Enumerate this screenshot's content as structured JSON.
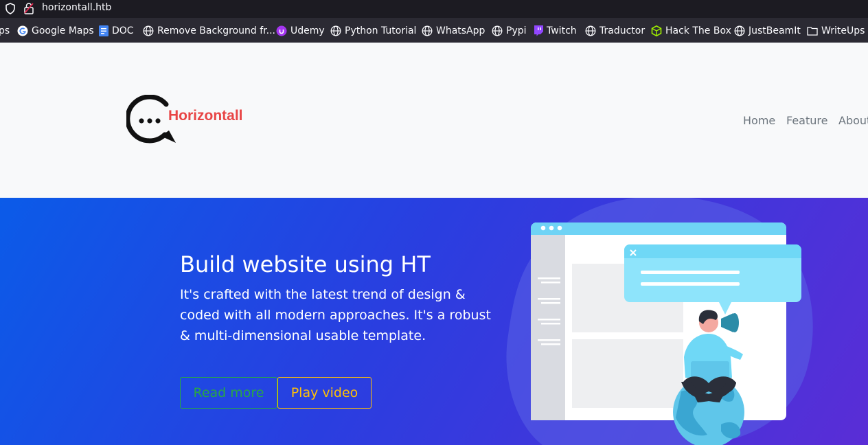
{
  "browser": {
    "url": "horizontall.htb",
    "bookmarks": [
      {
        "label": "ps",
        "icon": "apps-icon"
      },
      {
        "label": "Google Maps",
        "icon": "google-icon"
      },
      {
        "label": "DOC",
        "icon": "doc-icon"
      },
      {
        "label": "Remove Background fr...",
        "icon": "globe-icon"
      },
      {
        "label": "Udemy",
        "icon": "udemy-icon"
      },
      {
        "label": "Python Tutorial",
        "icon": "globe-icon"
      },
      {
        "label": "WhatsApp",
        "icon": "globe-icon"
      },
      {
        "label": "Pypi",
        "icon": "globe-icon"
      },
      {
        "label": "Twitch",
        "icon": "twitch-icon"
      },
      {
        "label": "Traductor",
        "icon": "globe-icon"
      },
      {
        "label": "Hack The Box",
        "icon": "htb-icon"
      },
      {
        "label": "JustBeamIt",
        "icon": "globe-icon"
      },
      {
        "label": "WriteUps H",
        "icon": "folder-icon"
      }
    ]
  },
  "site": {
    "brand": "Horizontall",
    "nav": [
      "Home",
      "Feature",
      "About"
    ]
  },
  "hero": {
    "title": "Build website using HT",
    "text": "It's crafted with the latest trend of design & coded with all modern approaches. It's a robust & multi-dimensional usable template.",
    "read_more": "Read more",
    "play_video": "Play video"
  },
  "colors": {
    "brand": "#e84545",
    "read_more": "#28a745",
    "play_video": "#ffc107",
    "hero_start": "#0b5be8",
    "hero_end": "#5a2dd6"
  }
}
